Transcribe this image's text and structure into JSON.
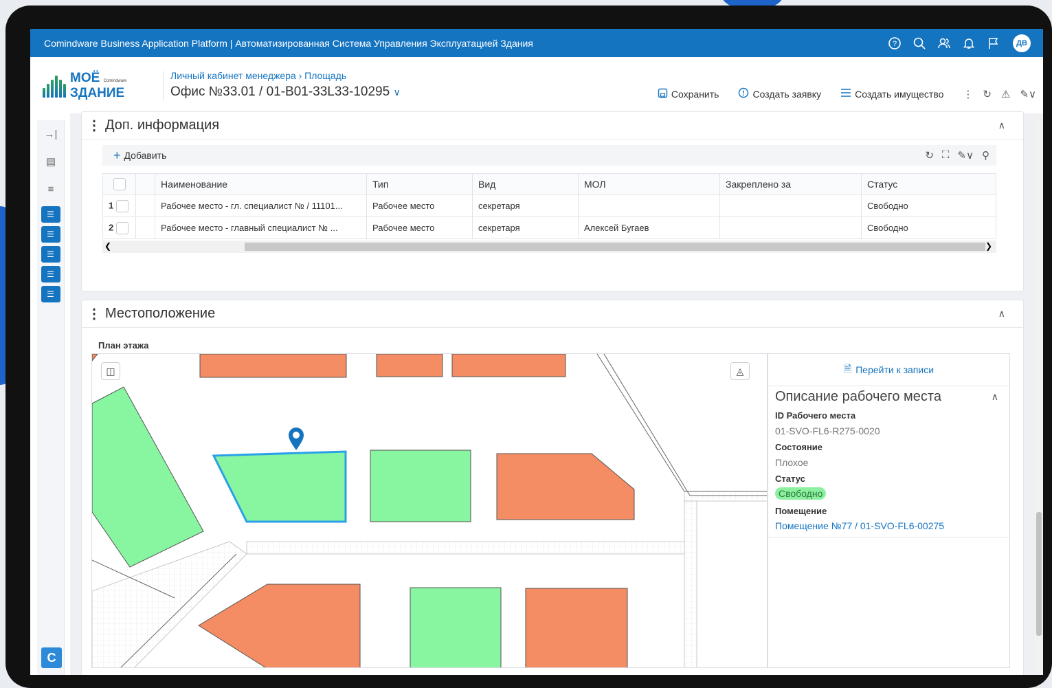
{
  "topbar": {
    "title": "Comindware Business Application Platform  |  Автоматизированная Система Управления Эксплуатацией Здания",
    "avatar": "ДВ"
  },
  "logo": {
    "line1": "МОЁ",
    "line2": "ЗДАНИЕ",
    "brand_small": "Comindware"
  },
  "header": {
    "breadcrumb": "Личный кабинет менеджера  ›  Площадь",
    "title": "Офис №33.01 / 01-B01-33L33-10295",
    "toolbar": {
      "save": "Сохранить",
      "create_request": "Создать заявку",
      "create_property": "Создать имущество"
    }
  },
  "extra_info": {
    "title": "Доп. информация",
    "add_label": "Добавить",
    "columns": [
      "Наименование",
      "Тип",
      "Вид",
      "МОЛ",
      "Закреплено за",
      "Статус"
    ],
    "rows": [
      {
        "n": "1",
        "name": "Рабочее место - гл. специалист № / 11101...",
        "type": "Рабочее место",
        "kind": "секретаря",
        "mol": "",
        "assigned": "",
        "status": "Свободно"
      },
      {
        "n": "2",
        "name": "Рабочее место - главный специалист № ...",
        "type": "Рабочее место",
        "kind": "секретаря",
        "mol": "Алексей Бугаев",
        "assigned": "",
        "status": "Свободно"
      }
    ]
  },
  "location": {
    "title": "Местоположение",
    "plan_label": "План этажа",
    "colors": {
      "free": "#88f5a0",
      "occupied": "#f48c64",
      "selected_outline": "#2aa0e8"
    }
  },
  "description": {
    "goto_label": "Перейти к записи",
    "title": "Описание рабочего места",
    "id_label": "ID Рабочего места",
    "id_value": "01-SVO-FL6-R275-0020",
    "state_label": "Состояние",
    "state_value": "Плохое",
    "status_label": "Статус",
    "status_value": "Свободно",
    "room_label": "Помещение",
    "room_value": "Помещение №77 / 01-SVO-FL6-00275"
  }
}
